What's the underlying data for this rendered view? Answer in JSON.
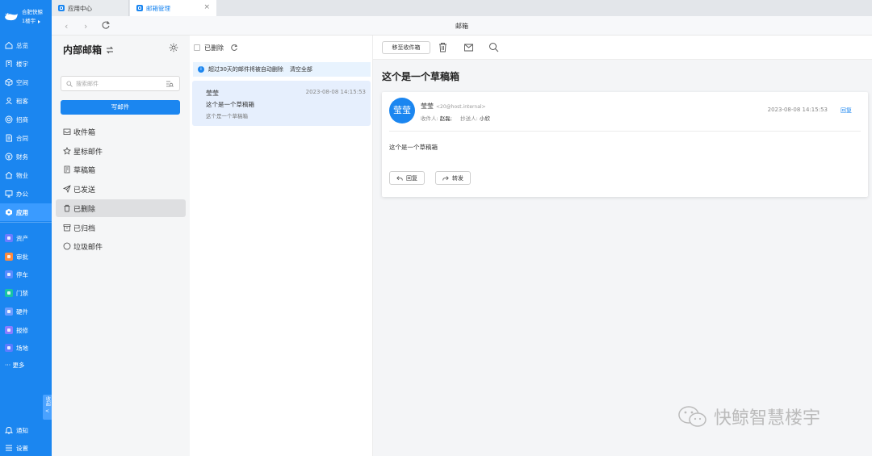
{
  "sidebar": {
    "brand_line1": "合肥快鲸",
    "brand_line2": "1楼宇",
    "nav": [
      {
        "label": "总览",
        "icon": "home-icon"
      },
      {
        "label": "楼宇",
        "icon": "building-icon"
      },
      {
        "label": "空间",
        "icon": "cube-icon"
      },
      {
        "label": "租客",
        "icon": "user-icon"
      },
      {
        "label": "招商",
        "icon": "target-icon"
      },
      {
        "label": "合同",
        "icon": "contract-icon"
      },
      {
        "label": "财务",
        "icon": "finance-icon"
      },
      {
        "label": "物业",
        "icon": "house-icon"
      },
      {
        "label": "办公",
        "icon": "monitor-icon"
      },
      {
        "label": "应用",
        "icon": "app-icon"
      }
    ],
    "active_nav": "应用",
    "apps": [
      {
        "label": "资产",
        "color": "#6b7cff"
      },
      {
        "label": "审批",
        "color": "#ff8a3d"
      },
      {
        "label": "停车",
        "color": "#5b8cff"
      },
      {
        "label": "门禁",
        "color": "#19c3a3"
      },
      {
        "label": "硬件",
        "color": "#6b9cff"
      },
      {
        "label": "报修",
        "color": "#8a7cff"
      },
      {
        "label": "场地",
        "color": "#5b7cff"
      }
    ],
    "more_label": "··· 更多",
    "collapse_label": "收起",
    "notify_label": "通知",
    "settings_label": "设置"
  },
  "tabs": [
    {
      "label": "应用中心",
      "color": "#1b86f0"
    },
    {
      "label": "邮箱管理",
      "color": "#1b86f0"
    }
  ],
  "address_bar": {
    "title": "邮箱"
  },
  "folders": {
    "header": "内部邮箱",
    "search_placeholder": "搜索邮件",
    "compose_label": "写邮件",
    "items": [
      {
        "label": "收件箱",
        "icon": "inbox-icon"
      },
      {
        "label": "星标邮件",
        "icon": "star-icon"
      },
      {
        "label": "草稿箱",
        "icon": "draft-icon"
      },
      {
        "label": "已发送",
        "icon": "send-icon"
      },
      {
        "label": "已删除",
        "icon": "trash-icon"
      },
      {
        "label": "已归档",
        "icon": "archive-icon"
      },
      {
        "label": "垃圾邮件",
        "icon": "spam-icon"
      }
    ],
    "active": "已删除"
  },
  "mail_list": {
    "folder_label": "已删除",
    "notice": "超过30天的邮件将被自动删除",
    "clear_label": "清空全部",
    "mails": [
      {
        "sender": "莹莹",
        "time": "2023-08-08 14:15:53",
        "subject": "这个是一个草稿箱",
        "preview": "这个是一个草稿箱"
      }
    ]
  },
  "reader": {
    "move_label": "移至收件箱",
    "subject": "这个是一个草稿箱",
    "avatar_text": "莹莹",
    "from_name": "莹莹",
    "from_email": "<20@host.internal>",
    "to_label": "收件人:",
    "to_value": "赵磊;",
    "cc_label": "抄送人:",
    "cc_value": "小欣",
    "time": "2023-08-08 14:15:53",
    "reply_link": "回复",
    "body": "这个是一个草稿箱",
    "reply_button": "回复",
    "forward_button": "转发"
  },
  "watermark": "快鲸智慧楼宇"
}
